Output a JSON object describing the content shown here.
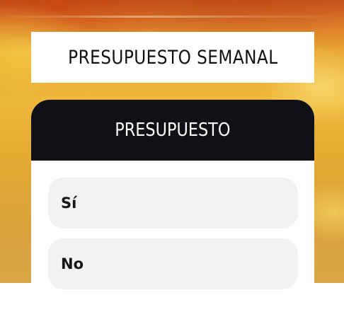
{
  "background": {
    "colors": [
      "#c4531a",
      "#e9a62f",
      "#efb83a"
    ]
  },
  "title": "PRESUPUESTO SEMANAL",
  "poll": {
    "header": "PRESUPUESTO",
    "header_bg": "#0f1114",
    "options": [
      {
        "label": "Sí"
      },
      {
        "label": "No"
      }
    ]
  }
}
